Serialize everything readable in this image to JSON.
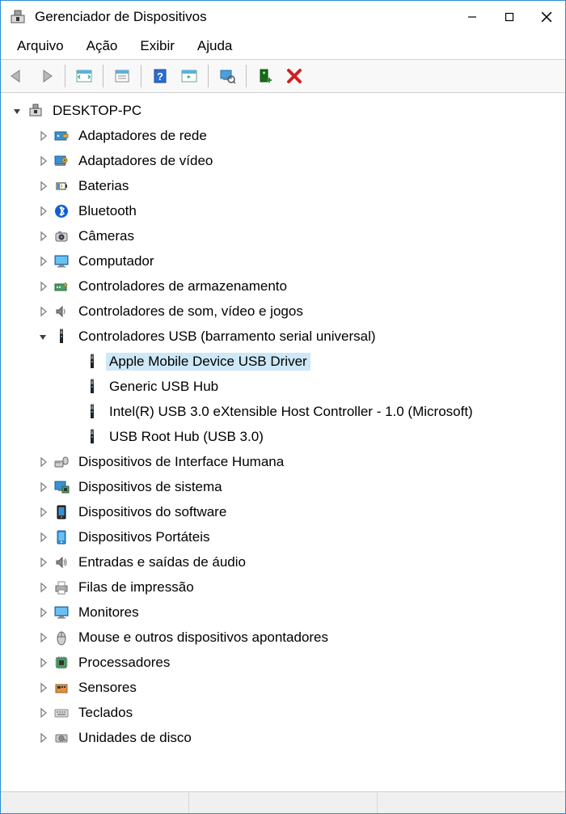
{
  "title": "Gerenciador de Dispositivos",
  "menubar": [
    "Arquivo",
    "Ação",
    "Exibir",
    "Ajuda"
  ],
  "root": {
    "label": "DESKTOP-PC",
    "icon": "computer-chip-icon",
    "expanded": true
  },
  "categories": [
    {
      "label": "Adaptadores de rede",
      "icon": "network-adapter-icon",
      "expanded": false,
      "children": []
    },
    {
      "label": "Adaptadores de vídeo",
      "icon": "display-adapter-icon",
      "expanded": false,
      "children": []
    },
    {
      "label": "Baterias",
      "icon": "battery-icon",
      "expanded": false,
      "children": []
    },
    {
      "label": "Bluetooth",
      "icon": "bluetooth-icon",
      "expanded": false,
      "children": []
    },
    {
      "label": "Câmeras",
      "icon": "camera-icon",
      "expanded": false,
      "children": []
    },
    {
      "label": "Computador",
      "icon": "monitor-icon",
      "expanded": false,
      "children": []
    },
    {
      "label": "Controladores de armazenamento",
      "icon": "storage-controller-icon",
      "expanded": false,
      "children": []
    },
    {
      "label": "Controladores de som, vídeo e jogos",
      "icon": "speaker-icon",
      "expanded": false,
      "children": []
    },
    {
      "label": "Controladores USB (barramento serial universal)",
      "icon": "usb-icon",
      "expanded": true,
      "children": [
        {
          "label": "Apple Mobile Device USB Driver",
          "icon": "usb-icon",
          "selected": true
        },
        {
          "label": "Generic USB Hub",
          "icon": "usb-icon"
        },
        {
          "label": "Intel(R) USB 3.0 eXtensible Host Controller - 1.0 (Microsoft)",
          "icon": "usb-icon"
        },
        {
          "label": "USB Root Hub (USB 3.0)",
          "icon": "usb-icon"
        }
      ]
    },
    {
      "label": "Dispositivos de Interface Humana",
      "icon": "hid-icon",
      "expanded": false,
      "children": []
    },
    {
      "label": "Dispositivos de sistema",
      "icon": "system-device-icon",
      "expanded": false,
      "children": []
    },
    {
      "label": "Dispositivos do software",
      "icon": "software-device-icon",
      "expanded": false,
      "children": []
    },
    {
      "label": "Dispositivos Portáteis",
      "icon": "portable-device-icon",
      "expanded": false,
      "children": []
    },
    {
      "label": "Entradas e saídas de áudio",
      "icon": "audio-io-icon",
      "expanded": false,
      "children": []
    },
    {
      "label": "Filas de impressão",
      "icon": "printer-icon",
      "expanded": false,
      "children": []
    },
    {
      "label": "Monitores",
      "icon": "monitor-icon",
      "expanded": false,
      "children": []
    },
    {
      "label": "Mouse e outros dispositivos apontadores",
      "icon": "mouse-icon",
      "expanded": false,
      "children": []
    },
    {
      "label": "Processadores",
      "icon": "processor-icon",
      "expanded": false,
      "children": []
    },
    {
      "label": "Sensores",
      "icon": "sensor-icon",
      "expanded": false,
      "children": []
    },
    {
      "label": "Teclados",
      "icon": "keyboard-icon",
      "expanded": false,
      "children": []
    },
    {
      "label": "Unidades de disco",
      "icon": "disk-drive-icon",
      "expanded": false,
      "children": []
    }
  ]
}
